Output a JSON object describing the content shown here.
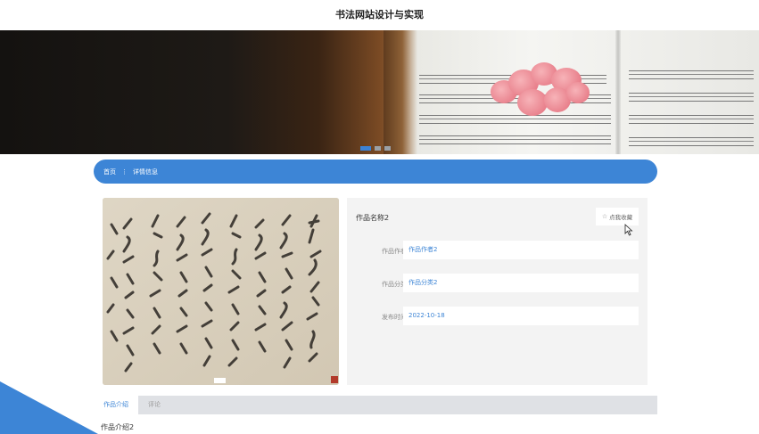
{
  "site": {
    "title": "书法网站设计与实现"
  },
  "banner": {
    "slides": 3,
    "active_slide": 1
  },
  "breadcrumb": {
    "home": "首页",
    "separator": "⋮",
    "current": "详情信息"
  },
  "work": {
    "name": "作品名称2",
    "favorite_label": "点我收藏",
    "fields": [
      {
        "label": "作品作者",
        "value": "作品作者2"
      },
      {
        "label": "作品分类",
        "value": "作品分类2"
      },
      {
        "label": "发布时间",
        "value": "2022-10-18"
      }
    ]
  },
  "tabs": [
    {
      "label": "作品介绍",
      "active": true
    },
    {
      "label": "评论",
      "active": false
    }
  ],
  "intro": {
    "text": "作品介绍2"
  },
  "colors": {
    "accent": "#3d85d6",
    "panel": "#f3f3f3",
    "tabbar": "#dfe1e5"
  },
  "icons": {
    "favorite": "star-outline-icon",
    "cursor": "mouse-pointer-icon"
  }
}
